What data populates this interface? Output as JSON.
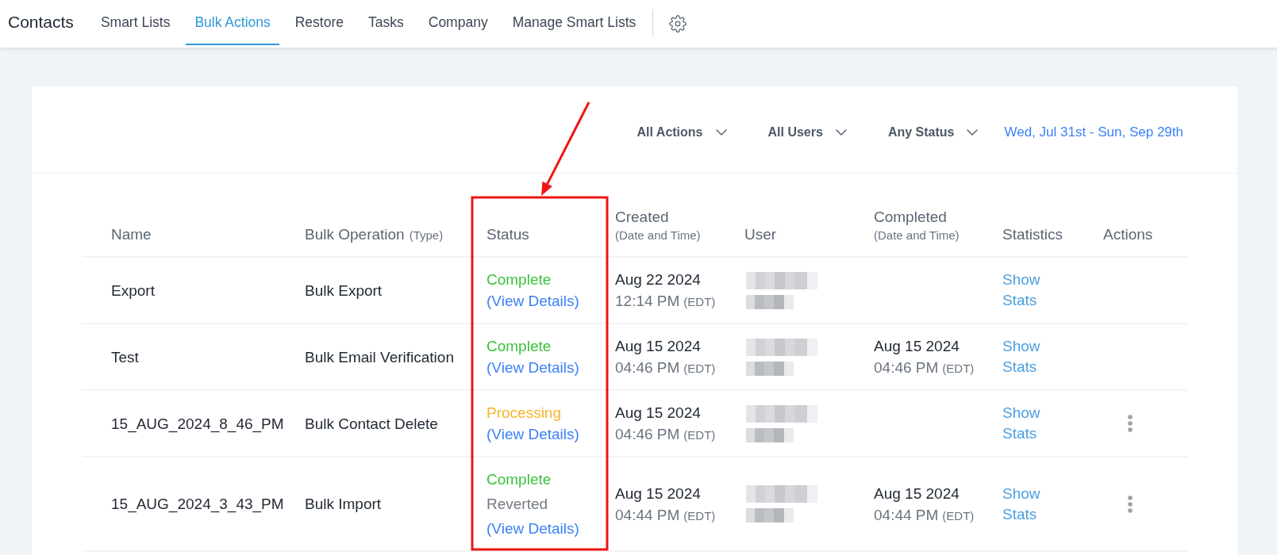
{
  "nav": {
    "title": "Contacts",
    "tabs": [
      {
        "label": "Smart Lists",
        "selected": false
      },
      {
        "label": "Bulk Actions",
        "selected": true
      },
      {
        "label": "Restore",
        "selected": false
      },
      {
        "label": "Tasks",
        "selected": false
      },
      {
        "label": "Company",
        "selected": false
      },
      {
        "label": "Manage Smart Lists",
        "selected": false
      }
    ]
  },
  "filters": {
    "dropdowns": [
      "All Actions",
      "All Users",
      "Any Status"
    ],
    "date_range": "Wed, Jul 31st - Sun, Sep 29th"
  },
  "table": {
    "columns": [
      {
        "label": "Name",
        "kind": "plain",
        "highlighted": false
      },
      {
        "label": "Bulk Operation",
        "note": "(Type)",
        "kind": "note_inline",
        "highlighted": false
      },
      {
        "label": "Status",
        "kind": "plain",
        "highlighted": true
      },
      {
        "label": "Created",
        "note": "(Date and Time)",
        "kind": "note_below",
        "highlighted": false
      },
      {
        "label": "User",
        "kind": "plain",
        "highlighted": false
      },
      {
        "label": "Completed",
        "note": "(Date and Time)",
        "kind": "note_below",
        "highlighted": false
      },
      {
        "label": "Statistics",
        "kind": "plain",
        "highlighted": false
      },
      {
        "label": "Actions",
        "kind": "plain",
        "highlighted": false
      }
    ],
    "rows": [
      {
        "name": "Export",
        "operation": "Bulk Export",
        "status": [
          {
            "text": "Complete",
            "kind": "complete"
          }
        ],
        "details_link": "(View Details)",
        "created": {
          "date": "Aug 22 2024",
          "time": "12:14 PM",
          "zone": "(EDT)"
        },
        "stats_link": "Show Stats",
        "menu": false
      },
      {
        "name": "Test",
        "operation": "Bulk Email Verification",
        "status": [
          {
            "text": "Complete",
            "kind": "complete"
          }
        ],
        "details_link": "(View Details)",
        "created": {
          "date": "Aug 15 2024",
          "time": "04:46 PM",
          "zone": "(EDT)"
        },
        "completed": {
          "date": "Aug 15 2024",
          "time": "04:46 PM",
          "zone": "(EDT)"
        },
        "stats_link": "Show Stats",
        "menu": false
      },
      {
        "name": "15_AUG_2024_8_46_PM",
        "operation": "Bulk Contact Delete",
        "status": [
          {
            "text": "Processing",
            "kind": "processing"
          }
        ],
        "details_link": "(View Details)",
        "created": {
          "date": "Aug 15 2024",
          "time": "04:46 PM",
          "zone": "(EDT)"
        },
        "stats_link": "Show Stats",
        "menu": true
      },
      {
        "name": "15_AUG_2024_3_43_PM",
        "operation": "Bulk Import",
        "status": [
          {
            "text": "Complete",
            "kind": "complete"
          },
          {
            "text": "Reverted",
            "kind": "reverted"
          }
        ],
        "details_link": "(View Details)",
        "created": {
          "date": "Aug 15 2024",
          "time": "04:44 PM",
          "zone": "(EDT)"
        },
        "completed": {
          "date": "Aug 15 2024",
          "time": "04:44 PM",
          "zone": "(EDT)"
        },
        "stats_link": "Show Stats",
        "menu": true
      }
    ]
  }
}
